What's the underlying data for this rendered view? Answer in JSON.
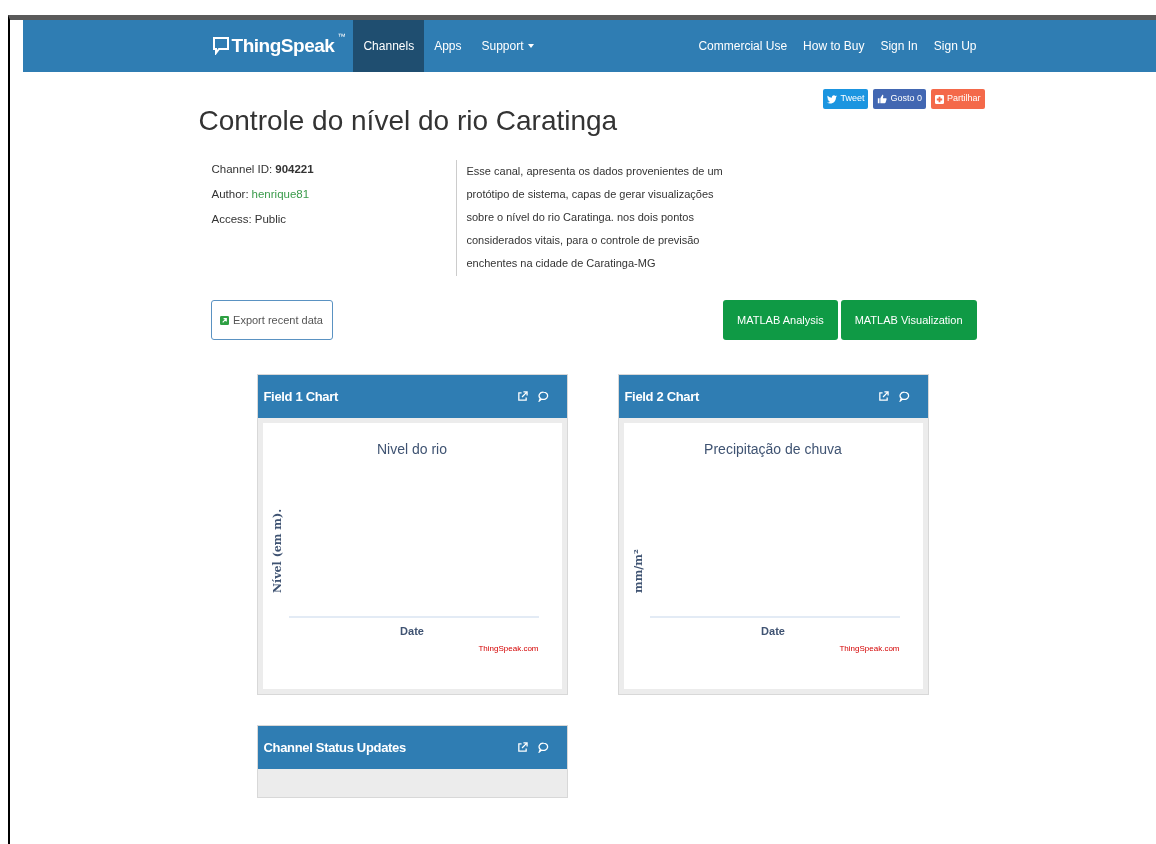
{
  "navbar": {
    "brand": "ThingSpeak",
    "trademark": "™",
    "left_items": [
      {
        "label": "Channels",
        "selected": true,
        "kind": "link"
      },
      {
        "label": "Apps",
        "selected": false,
        "kind": "link"
      },
      {
        "label": "Support",
        "selected": false,
        "kind": "dropdown"
      }
    ],
    "right_items": [
      {
        "label": "Commercial Use"
      },
      {
        "label": "How to Buy"
      },
      {
        "label": "Sign In"
      },
      {
        "label": "Sign Up"
      }
    ]
  },
  "social_buttons": [
    {
      "kind": "tweet",
      "label": "Tweet"
    },
    {
      "kind": "like",
      "label": "Gosto 0"
    },
    {
      "kind": "share",
      "label": "Partilhar"
    }
  ],
  "title": "Controle do nível do rio Caratinga",
  "meta": [
    {
      "label": "Channel ID:",
      "value": "904221",
      "kind": "bold"
    },
    {
      "label": "Author:",
      "value": "henrique81",
      "kind": "link"
    },
    {
      "label": "Access:",
      "value": "Public",
      "kind": "plain"
    }
  ],
  "description": "Esse canal, apresenta os dados provenientes de um protótipo de sistema, capas de gerar visualizações sobre o nível do rio Caratinga. nos dois pontos considerados vitais, para o controle de previsão enchentes na cidade de Caratinga-MG",
  "export_button": "Export recent data",
  "action_buttons": [
    "MATLAB Analysis",
    "MATLAB Visualization"
  ],
  "panels": [
    {
      "kind": "chart",
      "title": "Field 1 Chart",
      "chart": {
        "title": "Nivel do rio",
        "ylabel": "Nível (em m).",
        "xlabel": "Date",
        "credit": "ThingSpeak.com"
      }
    },
    {
      "kind": "chart",
      "title": "Field 2 Chart",
      "chart": {
        "title": "Precipitação de chuva",
        "ylabel": "mm/m²",
        "xlabel": "Date",
        "credit": "ThingSpeak.com"
      }
    },
    {
      "kind": "status",
      "title": "Channel Status Updates"
    }
  ]
}
